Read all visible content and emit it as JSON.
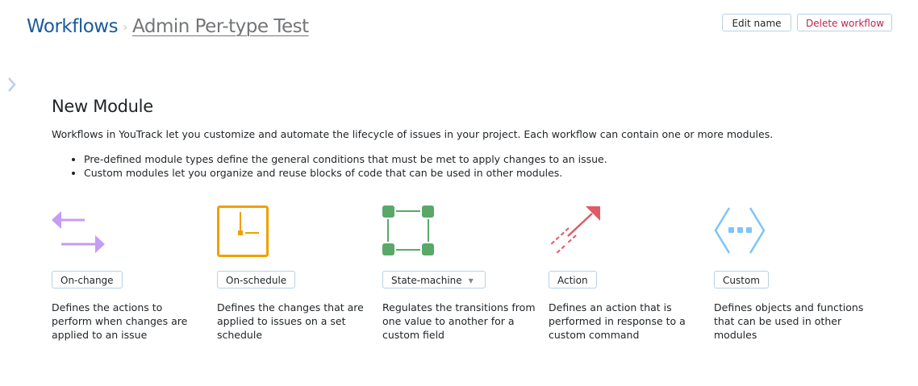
{
  "breadcrumb": {
    "root": "Workflows",
    "current": "Admin Per-type Test"
  },
  "header": {
    "edit_name": "Edit name",
    "delete_workflow": "Delete workflow"
  },
  "main": {
    "title": "New Module",
    "intro": "Workflows in YouTrack let you customize and automate the lifecycle of issues in your project. Each workflow can contain one or more modules.",
    "bullets": [
      "Pre-defined module types define the general conditions that must be met to apply changes to an issue.",
      "Custom modules let you organize and reuse blocks of code that can be used in other modules."
    ],
    "modules": [
      {
        "label": "On-change",
        "icon": "arrows-swap-icon",
        "color": "#c69cf5",
        "description": "Defines the actions to perform when changes are applied to an issue"
      },
      {
        "label": "On-schedule",
        "icon": "clock-icon",
        "color": "#f0a000",
        "description": "Defines the changes that are applied to issues on a set schedule"
      },
      {
        "label": "State-machine",
        "icon": "state-graph-icon",
        "color": "#59a869",
        "description": "Regulates the transitions from one value to another for a custom field"
      },
      {
        "label": "Action",
        "icon": "action-arrow-icon",
        "color": "#e05a66",
        "description": "Defines an action that is performed in response to a custom command"
      },
      {
        "label": "Custom",
        "icon": "code-brackets-icon",
        "color": "#7fc4f8",
        "description": "Defines objects and functions that can be used in other modules"
      }
    ]
  }
}
